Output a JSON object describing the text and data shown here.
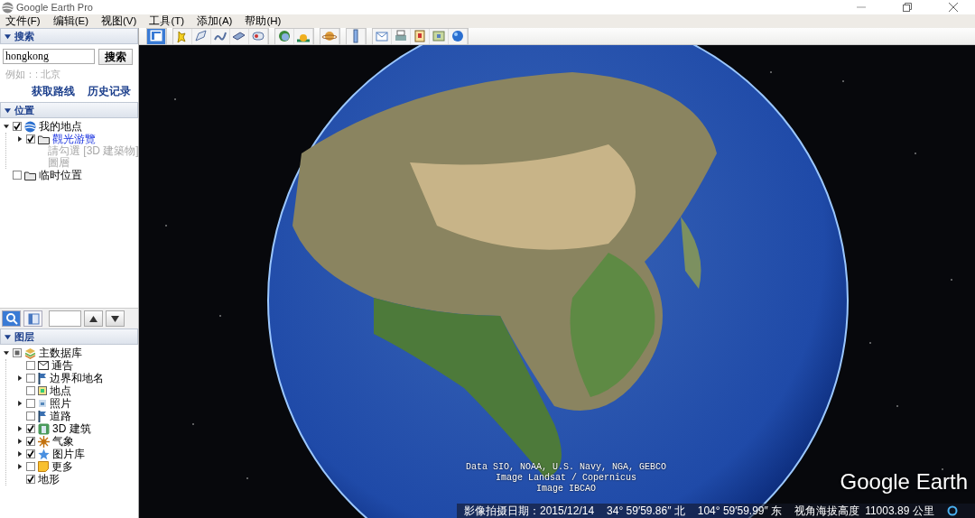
{
  "window": {
    "title": "Google Earth Pro"
  },
  "menu": [
    {
      "label": "文件(F)"
    },
    {
      "label": "编辑(E)"
    },
    {
      "label": "视图(V)"
    },
    {
      "label": "工具(T)"
    },
    {
      "label": "添加(A)"
    },
    {
      "label": "帮助(H)"
    }
  ],
  "search_panel": {
    "header": "搜索",
    "expanded": true,
    "query": "hongkong",
    "button": "搜索",
    "hint": "例如：: 北京",
    "links": [
      "获取路线",
      "历史记录"
    ]
  },
  "places_panel": {
    "header": "位置",
    "expanded": true,
    "tree": [
      {
        "label": "我的地点",
        "kind": "earth",
        "checked": true,
        "expanded": true,
        "selected": false,
        "children": [
          {
            "label": "觀光游覽",
            "kind": "folder",
            "checked": true,
            "expanded": false,
            "selected": true,
            "note": [
              "請勾選 [3D 建築物]",
              "圖層"
            ]
          }
        ]
      },
      {
        "label": "临时位置",
        "kind": "folder",
        "checked": false,
        "selected": false
      }
    ]
  },
  "layers_controls": [
    {
      "kind": "search",
      "selected": true
    },
    {
      "kind": "panel",
      "selected": false
    }
  ],
  "layers_panel": {
    "header": "图层",
    "expanded": true,
    "tree": [
      {
        "label": "主数据库",
        "kind": "database",
        "checked": false,
        "partial": true,
        "expanded": true,
        "children": [
          {
            "label": "通告",
            "kind": "envelope",
            "checked": false
          },
          {
            "label": "边界和地名",
            "kind": "flag",
            "checked": false,
            "expanded": false
          },
          {
            "label": "地点",
            "kind": "pin-square",
            "checked": false
          },
          {
            "label": "照片",
            "kind": "photo",
            "checked": false,
            "expanded": false
          },
          {
            "label": "道路",
            "kind": "flag",
            "checked": false
          },
          {
            "label": "3D 建筑",
            "kind": "building",
            "checked": true,
            "expanded": false
          },
          {
            "label": "气象",
            "kind": "sun",
            "checked": true,
            "expanded": false
          },
          {
            "label": "图片库",
            "kind": "star",
            "checked": true,
            "expanded": false
          },
          {
            "label": "更多",
            "kind": "note",
            "checked": false,
            "expanded": false
          },
          {
            "label": "地形",
            "kind": "plain",
            "checked": true
          }
        ]
      }
    ]
  },
  "toolbar": [
    [
      {
        "kind": "sidebar",
        "selected": true
      }
    ],
    [
      {
        "kind": "placemark",
        "selected": false
      },
      {
        "kind": "polygon",
        "selected": false
      },
      {
        "kind": "path",
        "selected": false
      },
      {
        "kind": "overlay",
        "selected": false
      },
      {
        "kind": "tour",
        "selected": false
      }
    ],
    [
      {
        "kind": "history",
        "selected": false
      },
      {
        "kind": "sunlight",
        "selected": false
      }
    ],
    [
      {
        "kind": "planet",
        "selected": false
      }
    ],
    [
      {
        "kind": "ruler",
        "selected": false
      }
    ],
    [
      {
        "kind": "email",
        "selected": false
      },
      {
        "kind": "print",
        "selected": false
      },
      {
        "kind": "save-image",
        "selected": false
      },
      {
        "kind": "map",
        "selected": false
      },
      {
        "kind": "globe",
        "selected": false
      }
    ]
  ],
  "view": {
    "attribution": [
      "Data SIO, NOAA, U.S. Navy, NGA, GEBCO",
      "Image Landsat / Copernicus",
      "Image IBCAO"
    ],
    "logo": "Google Earth"
  },
  "status_bar": {
    "date": "影像拍摄日期：2015/12/14",
    "latitude": "34° 59′59.86″ 北",
    "longitude": "104° 59′59.99″ 东",
    "altitude_label": "视角海拔高度",
    "altitude": "11003.89 公里"
  }
}
